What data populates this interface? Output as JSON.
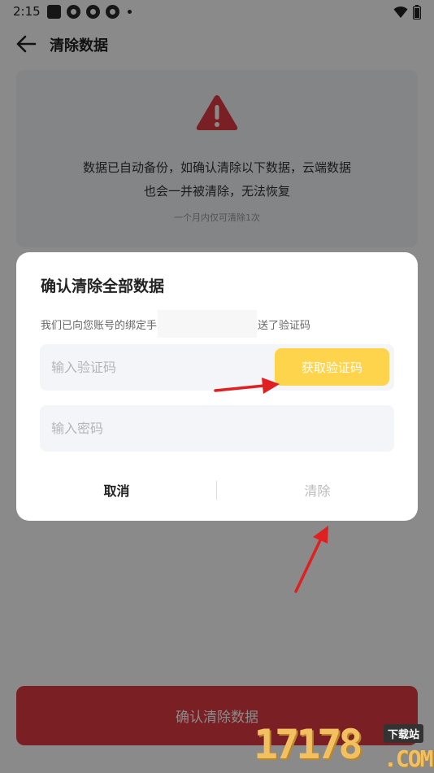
{
  "status_bar": {
    "time": "2:15"
  },
  "header": {
    "title": "清除数据",
    "back_icon": "arrow-left-icon"
  },
  "warning_card": {
    "icon": "warning-triangle-icon",
    "line1": "数据已自动备份，如确认清除以下数据，云端数据",
    "line2": "也会一并被清除，无法恢复",
    "hint": "一个月内仅可清除1次"
  },
  "confirm_button": {
    "label": "确认清除数据"
  },
  "dialog": {
    "title": "确认清除全部数据",
    "subtitle_prefix": "我们已向您账号的绑定手",
    "subtitle_suffix": "送了验证码",
    "code_placeholder": "输入验证码",
    "get_code_label": "获取验证码",
    "password_placeholder": "输入密码",
    "cancel_label": "取消",
    "clear_label": "清除"
  },
  "watermark": {
    "number": "17178",
    "badge": "下载站",
    "domain": ".COM"
  },
  "colors": {
    "accent_yellow": "#ffd44d",
    "danger_red": "#e23b43",
    "annotation_red": "#e02020"
  }
}
